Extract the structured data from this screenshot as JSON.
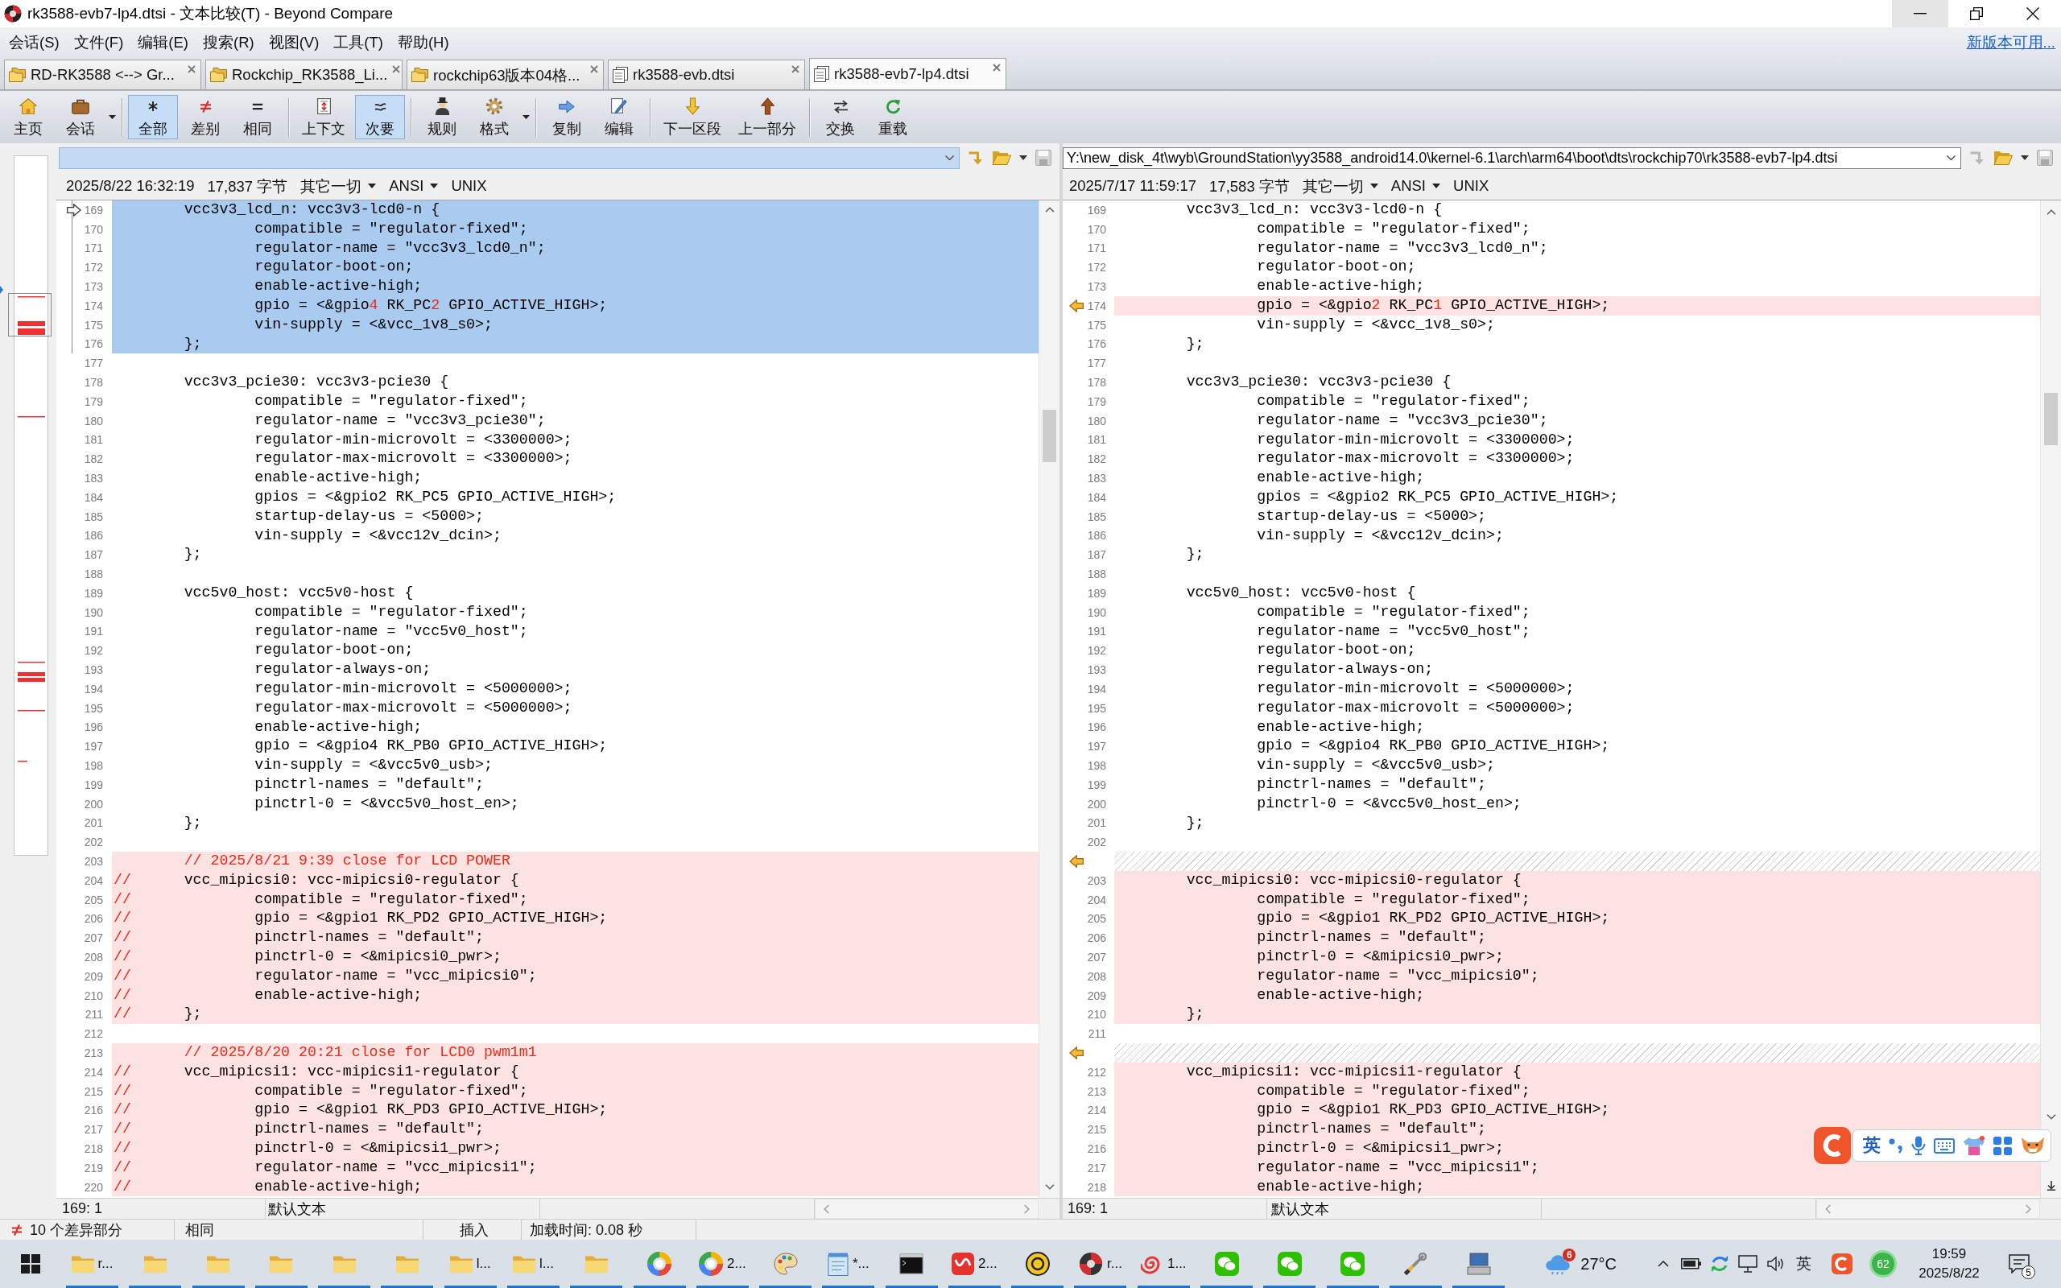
{
  "window": {
    "title": "rk3588-evb7-lp4.dtsi - 文本比较(T) - Beyond Compare",
    "controls": [
      {
        "kind": "minimize",
        "hovered": true
      },
      {
        "kind": "restore",
        "hovered": false
      },
      {
        "kind": "close",
        "hovered": false
      }
    ]
  },
  "menu_bar": {
    "items": [
      "会话(S)",
      "文件(F)",
      "编辑(E)",
      "搜索(R)",
      "视图(V)",
      "工具(T)",
      "帮助(H)"
    ],
    "update_link": "新版本可用..."
  },
  "tabs": [
    {
      "label": "RD-RK3588 <--> Gr...",
      "kind": "folder-compare",
      "selected": false
    },
    {
      "label": "Rockchip_RK3588_Li...",
      "kind": "folder-compare",
      "selected": false
    },
    {
      "label": "rockchip63版本04格...",
      "kind": "folder-compare",
      "selected": false
    },
    {
      "label": "rk3588-evb.dtsi",
      "kind": "text-compare",
      "selected": false
    },
    {
      "label": "rk3588-evb7-lp4.dtsi",
      "kind": "text-compare",
      "selected": true
    }
  ],
  "toolbar": {
    "groups": [
      {
        "buttons": [
          {
            "label": "主页",
            "kind": "home",
            "selected": false,
            "dropdown": false
          },
          {
            "label": "会话",
            "kind": "sessions",
            "selected": false,
            "dropdown": true
          }
        ]
      },
      {
        "buttons": [
          {
            "label": "全部",
            "kind": "all",
            "selected": true,
            "dropdown": false
          },
          {
            "label": "差别",
            "kind": "diffs",
            "selected": false,
            "dropdown": false
          },
          {
            "label": "相同",
            "kind": "same",
            "selected": false,
            "dropdown": false
          }
        ]
      },
      {
        "buttons": [
          {
            "label": "上下文",
            "kind": "context",
            "selected": false,
            "dropdown": false
          },
          {
            "label": "次要",
            "kind": "minor",
            "selected": true,
            "dropdown": false
          }
        ]
      },
      {
        "buttons": [
          {
            "label": "规则",
            "kind": "rules",
            "selected": false,
            "dropdown": false
          },
          {
            "label": "格式",
            "kind": "format",
            "selected": false,
            "dropdown": true
          }
        ]
      },
      {
        "buttons": [
          {
            "label": "复制",
            "kind": "copy",
            "selected": false,
            "dropdown": false
          },
          {
            "label": "编辑",
            "kind": "edit",
            "selected": false,
            "dropdown": false
          }
        ]
      },
      {
        "buttons": [
          {
            "label": "下一区段",
            "kind": "next-section",
            "selected": false,
            "dropdown": false
          },
          {
            "label": "上一部分",
            "kind": "prev-section",
            "selected": false,
            "dropdown": false
          }
        ]
      },
      {
        "buttons": [
          {
            "label": "交换",
            "kind": "swap",
            "selected": false,
            "dropdown": false
          },
          {
            "label": "重载",
            "kind": "reload",
            "selected": false,
            "dropdown": false
          }
        ]
      }
    ]
  },
  "panes": [
    {
      "path": {
        "focused": true,
        "navigate_enabled": true,
        "save_enabled": false
      },
      "info": {
        "modified": "2025/8/22 16:32:19",
        "size": "17,837 字节",
        "filter": "其它一切",
        "encoding": "ANSI",
        "line_endings": "UNIX"
      },
      "lines": [
        {
          "number": "169",
          "kind": "same",
          "selected": true,
          "marker": true,
          "text": "\tvcc3v3_lcd_n: vcc3v3-lcd0-n {"
        },
        {
          "number": "170",
          "kind": "same",
          "selected": true,
          "marker": false,
          "text": "\t\tcompatible = \"regulator-fixed\";"
        },
        {
          "number": "171",
          "kind": "same",
          "selected": true,
          "marker": false,
          "text": "\t\tregulator-name = \"vcc3v3_lcd0_n\";"
        },
        {
          "number": "172",
          "kind": "same",
          "selected": true,
          "marker": false,
          "text": "\t\tregulator-boot-on;"
        },
        {
          "number": "173",
          "kind": "same",
          "selected": true,
          "marker": false,
          "text": "\t\tenable-active-high;"
        },
        {
          "number": "174",
          "kind": "diff",
          "selected": true,
          "marker": false,
          "segments": [
            {
              "text": "\t\tgpio = <&gpio",
              "changed": false
            },
            {
              "text": "4",
              "changed": true
            },
            {
              "text": " RK_PC",
              "changed": false
            },
            {
              "text": "2",
              "changed": true
            },
            {
              "text": " GPIO_ACTIVE_HIGH>;",
              "changed": false
            }
          ]
        },
        {
          "number": "175",
          "kind": "same",
          "selected": true,
          "marker": false,
          "text": "\t\tvin-supply = <&vcc_1v8_s0>;"
        },
        {
          "number": "176",
          "kind": "same",
          "selected": true,
          "marker": false,
          "text": "\t};"
        },
        {
          "number": "177",
          "kind": "same",
          "selected": false,
          "marker": false
        },
        {
          "number": "178",
          "kind": "same",
          "selected": false,
          "marker": false,
          "text": "\tvcc3v3_pcie30: vcc3v3-pcie30 {"
        },
        {
          "number": "179",
          "kind": "same",
          "selected": false,
          "marker": false,
          "text": "\t\tcompatible = \"regulator-fixed\";"
        },
        {
          "number": "180",
          "kind": "same",
          "selected": false,
          "marker": false,
          "text": "\t\tregulator-name = \"vcc3v3_pcie30\";"
        },
        {
          "number": "181",
          "kind": "same",
          "selected": false,
          "marker": false,
          "text": "\t\tregulator-min-microvolt = <3300000>;"
        },
        {
          "number": "182",
          "kind": "same",
          "selected": false,
          "marker": false,
          "text": "\t\tregulator-max-microvolt = <3300000>;"
        },
        {
          "number": "183",
          "kind": "same",
          "selected": false,
          "marker": false,
          "text": "\t\tenable-active-high;"
        },
        {
          "number": "184",
          "kind": "same",
          "selected": false,
          "marker": false,
          "text": "\t\tgpios = <&gpio2 RK_PC5 GPIO_ACTIVE_HIGH>;"
        },
        {
          "number": "185",
          "kind": "same",
          "selected": false,
          "marker": false,
          "text": "\t\tstartup-delay-us = <5000>;"
        },
        {
          "number": "186",
          "kind": "same",
          "selected": false,
          "marker": false,
          "text": "\t\tvin-supply = <&vcc12v_dcin>;"
        },
        {
          "number": "187",
          "kind": "same",
          "selected": false,
          "marker": false,
          "text": "\t};"
        },
        {
          "number": "188",
          "kind": "same",
          "selected": false,
          "marker": false
        },
        {
          "number": "189",
          "kind": "same",
          "selected": false,
          "marker": false,
          "text": "\tvcc5v0_host: vcc5v0-host {"
        },
        {
          "number": "190",
          "kind": "same",
          "selected": false,
          "marker": false,
          "text": "\t\tcompatible = \"regulator-fixed\";"
        },
        {
          "number": "191",
          "kind": "same",
          "selected": false,
          "marker": false,
          "text": "\t\tregulator-name = \"vcc5v0_host\";"
        },
        {
          "number": "192",
          "kind": "same",
          "selected": false,
          "marker": false,
          "text": "\t\tregulator-boot-on;"
        },
        {
          "number": "193",
          "kind": "same",
          "selected": false,
          "marker": false,
          "text": "\t\tregulator-always-on;"
        },
        {
          "number": "194",
          "kind": "same",
          "selected": false,
          "marker": false,
          "text": "\t\tregulator-min-microvolt = <5000000>;"
        },
        {
          "number": "195",
          "kind": "same",
          "selected": false,
          "marker": false,
          "text": "\t\tregulator-max-microvolt = <5000000>;"
        },
        {
          "number": "196",
          "kind": "same",
          "selected": false,
          "marker": false,
          "text": "\t\tenable-active-high;"
        },
        {
          "number": "197",
          "kind": "same",
          "selected": false,
          "marker": false,
          "text": "\t\tgpio = <&gpio4 RK_PB0 GPIO_ACTIVE_HIGH>;"
        },
        {
          "number": "198",
          "kind": "same",
          "selected": false,
          "marker": false,
          "text": "\t\tvin-supply = <&vcc5v0_usb>;"
        },
        {
          "number": "199",
          "kind": "same",
          "selected": false,
          "marker": false,
          "text": "\t\tpinctrl-names = \"default\";"
        },
        {
          "number": "200",
          "kind": "same",
          "selected": false,
          "marker": false,
          "text": "\t\tpinctrl-0 = <&vcc5v0_host_en>;"
        },
        {
          "number": "201",
          "kind": "same",
          "selected": false,
          "marker": false,
          "text": "\t};"
        },
        {
          "number": "202",
          "kind": "same",
          "selected": false,
          "marker": false
        },
        {
          "number": "203",
          "kind": "diff",
          "selected": false,
          "marker": false,
          "segments": [
            {
              "text": "\t// 2025/8/21 9:39 close for LCD POWER",
              "changed": true
            }
          ]
        },
        {
          "number": "204",
          "kind": "diff",
          "selected": false,
          "marker": false,
          "segments": [
            {
              "text": "//",
              "changed": true
            },
            {
              "text": "\tvcc_mipicsi0: vcc-mipicsi0-regulator {",
              "changed": false
            }
          ]
        },
        {
          "number": "205",
          "kind": "diff",
          "selected": false,
          "marker": false,
          "segments": [
            {
              "text": "//",
              "changed": true
            },
            {
              "text": "\t\tcompatible = \"regulator-fixed\";",
              "changed": false
            }
          ]
        },
        {
          "number": "206",
          "kind": "diff",
          "selected": false,
          "marker": false,
          "segments": [
            {
              "text": "//",
              "changed": true
            },
            {
              "text": "\t\tgpio = <&gpio1 RK_PD2 GPIO_ACTIVE_HIGH>;",
              "changed": false
            }
          ]
        },
        {
          "number": "207",
          "kind": "diff",
          "selected": false,
          "marker": false,
          "segments": [
            {
              "text": "//",
              "changed": true
            },
            {
              "text": "\t\tpinctrl-names = \"default\";",
              "changed": false
            }
          ]
        },
        {
          "number": "208",
          "kind": "diff",
          "selected": false,
          "marker": false,
          "segments": [
            {
              "text": "//",
              "changed": true
            },
            {
              "text": "\t\tpinctrl-0 = <&mipicsi0_pwr>;",
              "changed": false
            }
          ]
        },
        {
          "number": "209",
          "kind": "diff",
          "selected": false,
          "marker": false,
          "segments": [
            {
              "text": "//",
              "changed": true
            },
            {
              "text": "\t\tregulator-name = \"vcc_mipicsi0\";",
              "changed": false
            }
          ]
        },
        {
          "number": "210",
          "kind": "diff",
          "selected": false,
          "marker": false,
          "segments": [
            {
              "text": "//",
              "changed": true
            },
            {
              "text": "\t\tenable-active-high;",
              "changed": false
            }
          ]
        },
        {
          "number": "211",
          "kind": "diff",
          "selected": false,
          "marker": false,
          "segments": [
            {
              "text": "//",
              "changed": true
            },
            {
              "text": "\t};",
              "changed": false
            }
          ]
        },
        {
          "number": "212",
          "kind": "same",
          "selected": false,
          "marker": false
        },
        {
          "number": "213",
          "kind": "diff",
          "selected": false,
          "marker": false,
          "segments": [
            {
              "text": "\t// 2025/8/20 20:21 close for LCD0 pwm1m1",
              "changed": true
            }
          ]
        },
        {
          "number": "214",
          "kind": "diff",
          "selected": false,
          "marker": false,
          "segments": [
            {
              "text": "//",
              "changed": true
            },
            {
              "text": "\tvcc_mipicsi1: vcc-mipicsi1-regulator {",
              "changed": false
            }
          ]
        },
        {
          "number": "215",
          "kind": "diff",
          "selected": false,
          "marker": false,
          "segments": [
            {
              "text": "//",
              "changed": true
            },
            {
              "text": "\t\tcompatible = \"regulator-fixed\";",
              "changed": false
            }
          ]
        },
        {
          "number": "216",
          "kind": "diff",
          "selected": false,
          "marker": false,
          "segments": [
            {
              "text": "//",
              "changed": true
            },
            {
              "text": "\t\tgpio = <&gpio1 RK_PD3 GPIO_ACTIVE_HIGH>;",
              "changed": false
            }
          ]
        },
        {
          "number": "217",
          "kind": "diff",
          "selected": false,
          "marker": false,
          "segments": [
            {
              "text": "//",
              "changed": true
            },
            {
              "text": "\t\tpinctrl-names = \"default\";",
              "changed": false
            }
          ]
        },
        {
          "number": "218",
          "kind": "diff",
          "selected": false,
          "marker": false,
          "segments": [
            {
              "text": "//",
              "changed": true
            },
            {
              "text": "\t\tpinctrl-0 = <&mipicsi1_pwr>;",
              "changed": false
            }
          ]
        },
        {
          "number": "219",
          "kind": "diff",
          "selected": false,
          "marker": false,
          "segments": [
            {
              "text": "//",
              "changed": true
            },
            {
              "text": "\t\tregulator-name = \"vcc_mipicsi1\";",
              "changed": false
            }
          ]
        },
        {
          "number": "220",
          "kind": "diff",
          "selected": false,
          "marker": false,
          "segments": [
            {
              "text": "//",
              "changed": true
            },
            {
              "text": "\t\tenable-active-high;",
              "changed": false
            }
          ]
        }
      ],
      "status": {
        "position": "169: 1",
        "format": "默认文本"
      }
    },
    {
      "path": {
        "value": "Y:\\new_disk_4t\\wyb\\GroundStation\\yy3588_android14.0\\kernel-6.1\\arch\\arm64\\boot\\dts\\rockchip70\\rk3588-evb7-lp4.dtsi",
        "focused": false,
        "navigate_enabled": false,
        "save_enabled": false
      },
      "info": {
        "modified": "2025/7/17 11:59:17",
        "size": "17,583 字节",
        "filter": "其它一切",
        "encoding": "ANSI",
        "line_endings": "UNIX"
      },
      "lines": [
        {
          "number": "169",
          "kind": "same",
          "selected": false,
          "marker": false,
          "text": "\tvcc3v3_lcd_n: vcc3v3-lcd0-n {"
        },
        {
          "number": "170",
          "kind": "same",
          "selected": false,
          "marker": false,
          "text": "\t\tcompatible = \"regulator-fixed\";"
        },
        {
          "number": "171",
          "kind": "same",
          "selected": false,
          "marker": false,
          "text": "\t\tregulator-name = \"vcc3v3_lcd0_n\";"
        },
        {
          "number": "172",
          "kind": "same",
          "selected": false,
          "marker": false,
          "text": "\t\tregulator-boot-on;"
        },
        {
          "number": "173",
          "kind": "same",
          "selected": false,
          "marker": false,
          "text": "\t\tenable-active-high;"
        },
        {
          "number": "174",
          "kind": "diff",
          "selected": false,
          "marker": true,
          "segments": [
            {
              "text": "\t\tgpio = <&gpio",
              "changed": false
            },
            {
              "text": "2",
              "changed": true
            },
            {
              "text": " RK_PC",
              "changed": false
            },
            {
              "text": "1",
              "changed": true
            },
            {
              "text": " GPIO_ACTIVE_HIGH>;",
              "changed": false
            }
          ]
        },
        {
          "number": "175",
          "kind": "same",
          "selected": false,
          "marker": false,
          "text": "\t\tvin-supply = <&vcc_1v8_s0>;"
        },
        {
          "number": "176",
          "kind": "same",
          "selected": false,
          "marker": false,
          "text": "\t};"
        },
        {
          "number": "177",
          "kind": "same",
          "selected": false,
          "marker": false
        },
        {
          "number": "178",
          "kind": "same",
          "selected": false,
          "marker": false,
          "text": "\tvcc3v3_pcie30: vcc3v3-pcie30 {"
        },
        {
          "number": "179",
          "kind": "same",
          "selected": false,
          "marker": false,
          "text": "\t\tcompatible = \"regulator-fixed\";"
        },
        {
          "number": "180",
          "kind": "same",
          "selected": false,
          "marker": false,
          "text": "\t\tregulator-name = \"vcc3v3_pcie30\";"
        },
        {
          "number": "181",
          "kind": "same",
          "selected": false,
          "marker": false,
          "text": "\t\tregulator-min-microvolt = <3300000>;"
        },
        {
          "number": "182",
          "kind": "same",
          "selected": false,
          "marker": false,
          "text": "\t\tregulator-max-microvolt = <3300000>;"
        },
        {
          "number": "183",
          "kind": "same",
          "selected": false,
          "marker": false,
          "text": "\t\tenable-active-high;"
        },
        {
          "number": "184",
          "kind": "same",
          "selected": false,
          "marker": false,
          "text": "\t\tgpios = <&gpio2 RK_PC5 GPIO_ACTIVE_HIGH>;"
        },
        {
          "number": "185",
          "kind": "same",
          "selected": false,
          "marker": false,
          "text": "\t\tstartup-delay-us = <5000>;"
        },
        {
          "number": "186",
          "kind": "same",
          "selected": false,
          "marker": false,
          "text": "\t\tvin-supply = <&vcc12v_dcin>;"
        },
        {
          "number": "187",
          "kind": "same",
          "selected": false,
          "marker": false,
          "text": "\t};"
        },
        {
          "number": "188",
          "kind": "same",
          "selected": false,
          "marker": false
        },
        {
          "number": "189",
          "kind": "same",
          "selected": false,
          "marker": false,
          "text": "\tvcc5v0_host: vcc5v0-host {"
        },
        {
          "number": "190",
          "kind": "same",
          "selected": false,
          "marker": false,
          "text": "\t\tcompatible = \"regulator-fixed\";"
        },
        {
          "number": "191",
          "kind": "same",
          "selected": false,
          "marker": false,
          "text": "\t\tregulator-name = \"vcc5v0_host\";"
        },
        {
          "number": "192",
          "kind": "same",
          "selected": false,
          "marker": false,
          "text": "\t\tregulator-boot-on;"
        },
        {
          "number": "193",
          "kind": "same",
          "selected": false,
          "marker": false,
          "text": "\t\tregulator-always-on;"
        },
        {
          "number": "194",
          "kind": "same",
          "selected": false,
          "marker": false,
          "text": "\t\tregulator-min-microvolt = <5000000>;"
        },
        {
          "number": "195",
          "kind": "same",
          "selected": false,
          "marker": false,
          "text": "\t\tregulator-max-microvolt = <5000000>;"
        },
        {
          "number": "196",
          "kind": "same",
          "selected": false,
          "marker": false,
          "text": "\t\tenable-active-high;"
        },
        {
          "number": "197",
          "kind": "same",
          "selected": false,
          "marker": false,
          "text": "\t\tgpio = <&gpio4 RK_PB0 GPIO_ACTIVE_HIGH>;"
        },
        {
          "number": "198",
          "kind": "same",
          "selected": false,
          "marker": false,
          "text": "\t\tvin-supply = <&vcc5v0_usb>;"
        },
        {
          "number": "199",
          "kind": "same",
          "selected": false,
          "marker": false,
          "text": "\t\tpinctrl-names = \"default\";"
        },
        {
          "number": "200",
          "kind": "same",
          "selected": false,
          "marker": false,
          "text": "\t\tpinctrl-0 = <&vcc5v0_host_en>;"
        },
        {
          "number": "201",
          "kind": "same",
          "selected": false,
          "marker": false,
          "text": "\t};"
        },
        {
          "number": "202",
          "kind": "same",
          "selected": false,
          "marker": false
        },
        {
          "kind": "gap",
          "selected": false,
          "marker": true
        },
        {
          "number": "203",
          "kind": "diff",
          "selected": false,
          "marker": false,
          "text": "\tvcc_mipicsi0: vcc-mipicsi0-regulator {"
        },
        {
          "number": "204",
          "kind": "diff",
          "selected": false,
          "marker": false,
          "text": "\t\tcompatible = \"regulator-fixed\";"
        },
        {
          "number": "205",
          "kind": "diff",
          "selected": false,
          "marker": false,
          "text": "\t\tgpio = <&gpio1 RK_PD2 GPIO_ACTIVE_HIGH>;"
        },
        {
          "number": "206",
          "kind": "diff",
          "selected": false,
          "marker": false,
          "text": "\t\tpinctrl-names = \"default\";"
        },
        {
          "number": "207",
          "kind": "diff",
          "selected": false,
          "marker": false,
          "text": "\t\tpinctrl-0 = <&mipicsi0_pwr>;"
        },
        {
          "number": "208",
          "kind": "diff",
          "selected": false,
          "marker": false,
          "text": "\t\tregulator-name = \"vcc_mipicsi0\";"
        },
        {
          "number": "209",
          "kind": "diff",
          "selected": false,
          "marker": false,
          "text": "\t\tenable-active-high;"
        },
        {
          "number": "210",
          "kind": "diff",
          "selected": false,
          "marker": false,
          "text": "\t};"
        },
        {
          "number": "211",
          "kind": "same",
          "selected": false,
          "marker": false
        },
        {
          "kind": "gap",
          "selected": false,
          "marker": true
        },
        {
          "number": "212",
          "kind": "diff",
          "selected": false,
          "marker": false,
          "text": "\tvcc_mipicsi1: vcc-mipicsi1-regulator {"
        },
        {
          "number": "213",
          "kind": "diff",
          "selected": false,
          "marker": false,
          "text": "\t\tcompatible = \"regulator-fixed\";"
        },
        {
          "number": "214",
          "kind": "diff",
          "selected": false,
          "marker": false,
          "text": "\t\tgpio = <&gpio1 RK_PD3 GPIO_ACTIVE_HIGH>;"
        },
        {
          "number": "215",
          "kind": "diff",
          "selected": false,
          "marker": false,
          "text": "\t\tpinctrl-names = \"default\";"
        },
        {
          "number": "216",
          "kind": "diff",
          "selected": false,
          "marker": false,
          "text": "\t\tpinctrl-0 = <&mipicsi1_pwr>;"
        },
        {
          "number": "217",
          "kind": "diff",
          "selected": false,
          "marker": false,
          "text": "\t\tregulator-name = \"vcc_mipicsi1\";"
        },
        {
          "number": "218",
          "kind": "diff",
          "selected": false,
          "marker": false,
          "text": "\t\tenable-active-high;"
        }
      ],
      "status": {
        "position": "169: 1",
        "format": "默认文本"
      }
    }
  ],
  "status_bar": {
    "differences": "10 个差异部分",
    "filter": "相同",
    "edit_mode": "插入",
    "load_time": "加载时间: 0.08 秒"
  },
  "taskbar": {
    "apps": [
      {
        "kind": "folder",
        "label": "r...",
        "running": true
      },
      {
        "kind": "folder",
        "running": true
      },
      {
        "kind": "folder",
        "running": true
      },
      {
        "kind": "folder",
        "running": true
      },
      {
        "kind": "folder",
        "running": true
      },
      {
        "kind": "folder",
        "running": true
      },
      {
        "kind": "folder",
        "label": "l...",
        "running": true
      },
      {
        "kind": "folder",
        "label": "l...",
        "running": true
      },
      {
        "kind": "folder",
        "running": true
      },
      {
        "kind": "color-ring",
        "running": true
      },
      {
        "kind": "color-ring",
        "label": "2...",
        "running": true
      },
      {
        "kind": "paint",
        "running": true
      },
      {
        "kind": "notepad",
        "label": "*...",
        "running": true
      },
      {
        "kind": "terminal",
        "running": true
      },
      {
        "kind": "office",
        "label": "2...",
        "running": true
      },
      {
        "kind": "editor",
        "running": true
      },
      {
        "kind": "compare",
        "label": "r...",
        "running": true
      },
      {
        "kind": "spiral",
        "label": "1...",
        "running": true
      },
      {
        "kind": "chat",
        "running": true
      },
      {
        "kind": "chat",
        "running": true
      },
      {
        "kind": "chat",
        "running": true
      },
      {
        "kind": "tools",
        "running": true
      },
      {
        "kind": "network",
        "running": true
      }
    ],
    "weather": {
      "alerts": "6",
      "temperature": "27°C"
    },
    "tray": {
      "input_mode": "英",
      "usage": "62"
    },
    "clock": {
      "time": "19:59",
      "date": "2025/8/22"
    },
    "notifications": "5"
  },
  "ime_toolbar": {
    "mode": "英"
  }
}
